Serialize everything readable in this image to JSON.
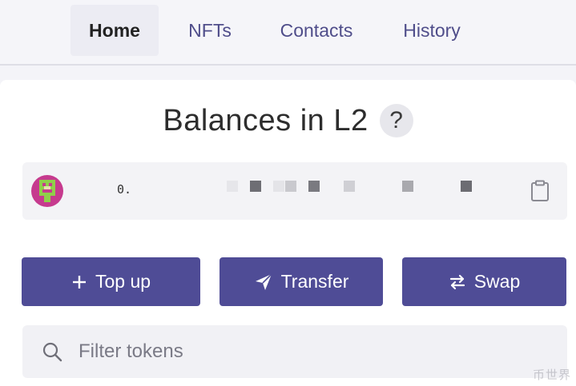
{
  "nav": {
    "tabs": [
      {
        "label": "Home",
        "active": true
      },
      {
        "label": "NFTs",
        "active": false
      },
      {
        "label": "Contacts",
        "active": false
      },
      {
        "label": "History",
        "active": false
      }
    ]
  },
  "balances": {
    "title": "Balances in L2",
    "help_label": "?"
  },
  "account": {
    "address_prefix": "0.",
    "avatar_icon": "identicon-avatar",
    "copy_icon": "clipboard-icon"
  },
  "actions": {
    "top_up_label": "Top up",
    "transfer_label": "Transfer",
    "swap_label": "Swap"
  },
  "filter": {
    "placeholder": "Filter tokens",
    "value": ""
  },
  "watermark": "币世界",
  "colors": {
    "accent": "#4f4c96",
    "nav_text": "#4f4d8a",
    "address_bg": "#f3f3f6"
  }
}
